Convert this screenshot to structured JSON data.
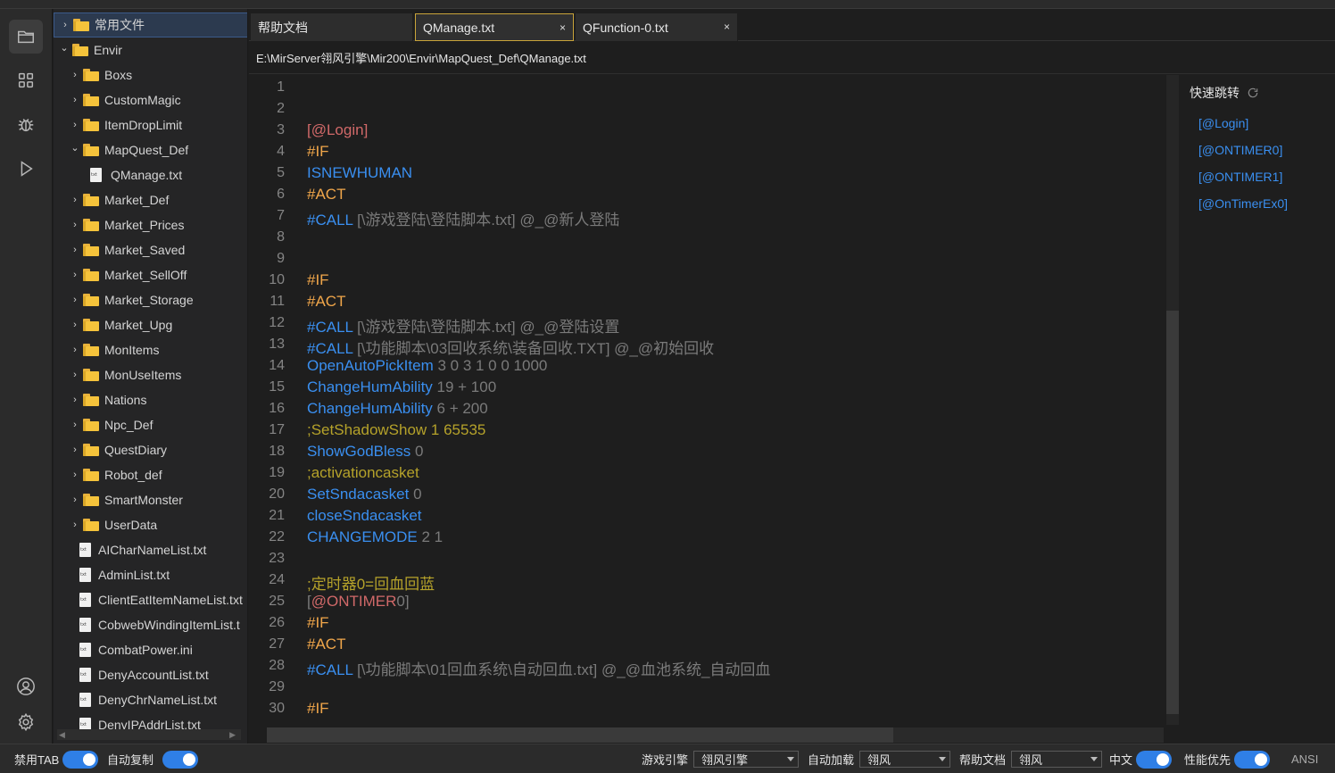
{
  "tree": {
    "items": [
      {
        "label": "常用文件",
        "kind": "folder",
        "expanded": false,
        "depth": 0,
        "selected": true
      },
      {
        "label": "Envir",
        "kind": "folder",
        "expanded": true,
        "depth": 0
      },
      {
        "label": "Boxs",
        "kind": "folder",
        "expanded": false,
        "depth": 1
      },
      {
        "label": "CustomMagic",
        "kind": "folder",
        "expanded": false,
        "depth": 1
      },
      {
        "label": "ItemDropLimit",
        "kind": "folder",
        "expanded": false,
        "depth": 1
      },
      {
        "label": "MapQuest_Def",
        "kind": "folder",
        "expanded": true,
        "depth": 1
      },
      {
        "label": "QManage.txt",
        "kind": "file",
        "depth": 2
      },
      {
        "label": "Market_Def",
        "kind": "folder",
        "expanded": false,
        "depth": 1
      },
      {
        "label": "Market_Prices",
        "kind": "folder",
        "expanded": false,
        "depth": 1
      },
      {
        "label": "Market_Saved",
        "kind": "folder",
        "expanded": false,
        "depth": 1
      },
      {
        "label": "Market_SellOff",
        "kind": "folder",
        "expanded": false,
        "depth": 1
      },
      {
        "label": "Market_Storage",
        "kind": "folder",
        "expanded": false,
        "depth": 1
      },
      {
        "label": "Market_Upg",
        "kind": "folder",
        "expanded": false,
        "depth": 1
      },
      {
        "label": "MonItems",
        "kind": "folder",
        "expanded": false,
        "depth": 1
      },
      {
        "label": "MonUseItems",
        "kind": "folder",
        "expanded": false,
        "depth": 1
      },
      {
        "label": "Nations",
        "kind": "folder",
        "expanded": false,
        "depth": 1
      },
      {
        "label": "Npc_Def",
        "kind": "folder",
        "expanded": false,
        "depth": 1
      },
      {
        "label": "QuestDiary",
        "kind": "folder",
        "expanded": false,
        "depth": 1
      },
      {
        "label": "Robot_def",
        "kind": "folder",
        "expanded": false,
        "depth": 1
      },
      {
        "label": "SmartMonster",
        "kind": "folder",
        "expanded": false,
        "depth": 1
      },
      {
        "label": "UserData",
        "kind": "folder",
        "expanded": false,
        "depth": 1
      },
      {
        "label": "AICharNameList.txt",
        "kind": "file",
        "depth": 1
      },
      {
        "label": "AdminList.txt",
        "kind": "file",
        "depth": 1
      },
      {
        "label": "ClientEatItemNameList.txt",
        "kind": "file",
        "depth": 1
      },
      {
        "label": "CobwebWindingItemList.t",
        "kind": "file",
        "depth": 1
      },
      {
        "label": "CombatPower.ini",
        "kind": "file",
        "depth": 1
      },
      {
        "label": "DenyAccountList.txt",
        "kind": "file",
        "depth": 1
      },
      {
        "label": "DenyChrNameList.txt",
        "kind": "file",
        "depth": 1
      },
      {
        "label": "DenyIPAddrList.txt",
        "kind": "file",
        "depth": 1
      }
    ]
  },
  "tabs": [
    {
      "label": "帮助文档",
      "active": false,
      "closable": false
    },
    {
      "label": "QManage.txt",
      "active": true,
      "closable": true
    },
    {
      "label": "QFunction-0.txt",
      "active": false,
      "closable": true
    }
  ],
  "tab_close_glyph": "×",
  "path": "E:\\MirServer翎风引擎\\Mir200\\Envir\\MapQuest_Def\\QManage.txt",
  "editor": {
    "lines": [
      {
        "n": "1",
        "parts": []
      },
      {
        "n": "2",
        "parts": []
      },
      {
        "n": "3",
        "parts": [
          {
            "t": "[@Login]",
            "c": "c-label"
          }
        ]
      },
      {
        "n": "4",
        "parts": [
          {
            "t": "#IF",
            "c": "c-kw"
          }
        ]
      },
      {
        "n": "5",
        "parts": [
          {
            "t": "ISNEWHUMAN",
            "c": "c-cmd"
          }
        ]
      },
      {
        "n": "6",
        "parts": [
          {
            "t": "#ACT",
            "c": "c-kw"
          }
        ]
      },
      {
        "n": "7",
        "parts": [
          {
            "t": "#CALL",
            "c": "c-cmd"
          },
          {
            "t": " [\\游戏登陆\\登陆脚本.txt] @_@新人登陆",
            "c": "c-arg"
          }
        ]
      },
      {
        "n": "8",
        "parts": []
      },
      {
        "n": "9",
        "parts": []
      },
      {
        "n": "10",
        "parts": [
          {
            "t": "#IF",
            "c": "c-kw"
          }
        ]
      },
      {
        "n": "11",
        "parts": [
          {
            "t": "#ACT",
            "c": "c-kw"
          }
        ]
      },
      {
        "n": "12",
        "parts": [
          {
            "t": "#CALL",
            "c": "c-cmd"
          },
          {
            "t": " [\\游戏登陆\\登陆脚本.txt] @_@登陆设置",
            "c": "c-arg"
          }
        ]
      },
      {
        "n": "13",
        "parts": [
          {
            "t": "#CALL",
            "c": "c-cmd"
          },
          {
            "t": " [\\功能脚本\\03回收系统\\装备回收.TXT] @_@初始回收",
            "c": "c-arg"
          }
        ]
      },
      {
        "n": "14",
        "parts": [
          {
            "t": "OpenAutoPickItem",
            "c": "c-cmd"
          },
          {
            "t": " 3 0 3 1 0 0 1000",
            "c": "c-arg"
          }
        ]
      },
      {
        "n": "15",
        "parts": [
          {
            "t": "ChangeHumAbility",
            "c": "c-cmd"
          },
          {
            "t": " 19 + 100",
            "c": "c-arg"
          }
        ]
      },
      {
        "n": "16",
        "parts": [
          {
            "t": "ChangeHumAbility",
            "c": "c-cmd"
          },
          {
            "t": " 6 + 200",
            "c": "c-arg"
          }
        ]
      },
      {
        "n": "17",
        "parts": [
          {
            "t": ";SetShadowShow 1 65535",
            "c": "c-cmt"
          }
        ]
      },
      {
        "n": "18",
        "parts": [
          {
            "t": "ShowGodBless",
            "c": "c-cmd"
          },
          {
            "t": " 0",
            "c": "c-arg"
          }
        ]
      },
      {
        "n": "19",
        "parts": [
          {
            "t": ";activationcasket",
            "c": "c-cmt"
          }
        ]
      },
      {
        "n": "20",
        "parts": [
          {
            "t": "SetSndacasket",
            "c": "c-cmd"
          },
          {
            "t": " 0",
            "c": "c-arg"
          }
        ]
      },
      {
        "n": "21",
        "parts": [
          {
            "t": "closeSndacasket",
            "c": "c-cmd"
          }
        ]
      },
      {
        "n": "22",
        "parts": [
          {
            "t": "CHANGEMODE",
            "c": "c-cmd"
          },
          {
            "t": " 2 1",
            "c": "c-arg"
          }
        ]
      },
      {
        "n": "23",
        "parts": []
      },
      {
        "n": "24",
        "parts": [
          {
            "t": ";定时器0=回血回蓝",
            "c": "c-cmt"
          }
        ]
      },
      {
        "n": "25",
        "parts": [
          {
            "t": "[",
            "c": "c-arg"
          },
          {
            "t": "@ONTIMER",
            "c": "c-label"
          },
          {
            "t": "0]",
            "c": "c-arg"
          }
        ]
      },
      {
        "n": "26",
        "parts": [
          {
            "t": "#IF",
            "c": "c-kw"
          }
        ]
      },
      {
        "n": "27",
        "parts": [
          {
            "t": "#ACT",
            "c": "c-kw"
          }
        ]
      },
      {
        "n": "28",
        "parts": [
          {
            "t": "#CALL",
            "c": "c-cmd"
          },
          {
            "t": " [\\功能脚本\\01回血系统\\自动回血.txt] @_@血池系统_自动回血",
            "c": "c-arg"
          }
        ]
      },
      {
        "n": "29",
        "parts": []
      },
      {
        "n": "30",
        "parts": [
          {
            "t": "#IF",
            "c": "c-kw"
          }
        ]
      }
    ]
  },
  "quick_jump": {
    "title": "快速跳转",
    "items": [
      "[@Login]",
      "[@ONTIMER0]",
      "[@ONTIMER1]",
      "[@OnTimerEx0]"
    ]
  },
  "status": {
    "disable_tab": "禁用TAB",
    "auto_copy": "自动复制",
    "game_engine_label": "游戏引擎",
    "game_engine_value": "翎风引擎",
    "auto_load_label": "自动加载",
    "auto_load_value": "翎风",
    "help_doc_label": "帮助文档",
    "help_doc_value": "翎风",
    "chinese_label": "中文",
    "performance_label": "性能优先",
    "encoding": "ANSI"
  },
  "colors": {
    "accent": "#2f7fe6",
    "keyword": "#f0a64a",
    "command": "#3a8ff0",
    "label": "#d16969",
    "comment": "#b5a22a",
    "argument": "#7a7a7a",
    "folder": "#f5c33b"
  }
}
